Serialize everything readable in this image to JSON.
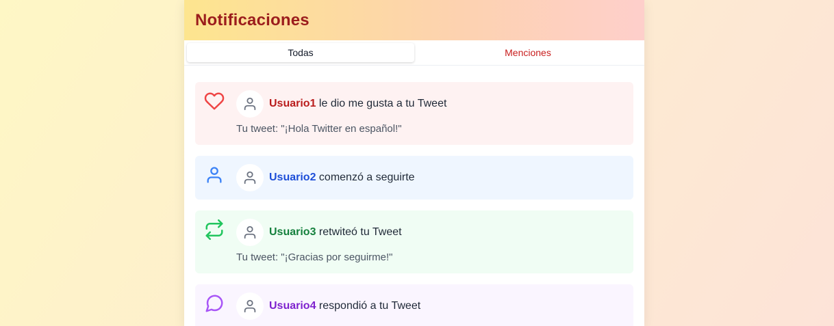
{
  "header": {
    "title": "Notificaciones"
  },
  "tabs": [
    {
      "label": "Todas",
      "active": true
    },
    {
      "label": "Menciones",
      "active": false
    }
  ],
  "notifications": [
    {
      "type": "like",
      "icon": "heart-icon",
      "user": "Usuario1",
      "action": "le dio me gusta a tu Tweet",
      "tweet": "Tu tweet: \"¡Hola Twitter en español!\"",
      "color": "#ef4444"
    },
    {
      "type": "follow",
      "icon": "user-icon",
      "user": "Usuario2",
      "action": "comenzó a seguirte",
      "color": "#3b82f6"
    },
    {
      "type": "retweet",
      "icon": "retweet-icon",
      "user": "Usuario3",
      "action": "retwiteó tu Tweet",
      "tweet": "Tu tweet: \"¡Gracias por seguirme!\"",
      "color": "#22c55e"
    },
    {
      "type": "reply",
      "icon": "message-circle-icon",
      "user": "Usuario4",
      "action": "respondió a tu Tweet",
      "color": "#a855f7"
    }
  ]
}
